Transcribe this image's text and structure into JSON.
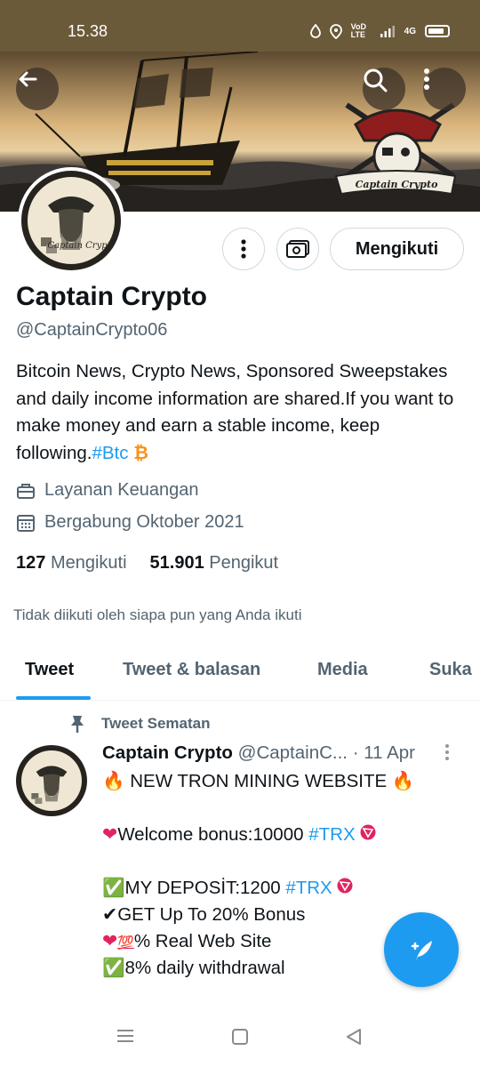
{
  "status_bar": {
    "time": "15.38",
    "network_label": "VoD LTE",
    "signal_label": "4G",
    "icons": [
      "water-drop-icon",
      "location-icon",
      "signal-icon",
      "battery-icon"
    ]
  },
  "banner": {
    "logo_text": "Captain Crypto",
    "icons": [
      "back-arrow-icon",
      "search-icon",
      "more-vertical-icon"
    ]
  },
  "profile": {
    "avatar_text": "Captain Crypto",
    "follow_button": "Mengikuti",
    "name": "Captain Crypto",
    "handle": "@CaptainCrypto06",
    "bio_text": "Bitcoin News, Crypto News, Sponsored Sweepstakes and daily income information are shared.If you want to make money and earn a stable income, keep following.",
    "bio_hashtag": "#Btc",
    "bio_emoji": "₿",
    "category": "Layanan Keuangan",
    "joined": "Bergabung Oktober 2021",
    "following_count": "127",
    "following_label": "Mengikuti",
    "followers_count": "51.901",
    "followers_label": "Pengikut",
    "not_followed_note": "Tidak diikuti oleh siapa pun yang Anda ikuti"
  },
  "tabs": [
    {
      "label": "Tweet",
      "active": true
    },
    {
      "label": "Tweet & balasan",
      "active": false
    },
    {
      "label": "Media",
      "active": false
    },
    {
      "label": "Suka",
      "active": false
    }
  ],
  "pinned_tweet": {
    "pinned_label": "Tweet Sematan",
    "author_name": "Captain Crypto",
    "author_handle": "@CaptainC...",
    "date": "· 11 Apr",
    "lines": {
      "l1": "NEW TRON MINING WEBSITE",
      "l2": "Welcome bonus:10000",
      "l2_tag": "#TRX",
      "l3": "MY DEPOSİT:1200",
      "l3_tag": "#TRX",
      "l4": "GET Up To 20% Bonus",
      "l5": "% Real Web Site",
      "l6": "8% daily withdrawal"
    }
  },
  "colors": {
    "accent": "#1d9bf0",
    "text_primary": "#0f1419",
    "text_secondary": "#536471",
    "status_bar_bg": "#6b5a3a",
    "bitcoin": "#f7931a"
  },
  "nav_bar": {
    "icons": [
      "menu-icon",
      "home-square-icon",
      "back-triangle-icon"
    ]
  }
}
